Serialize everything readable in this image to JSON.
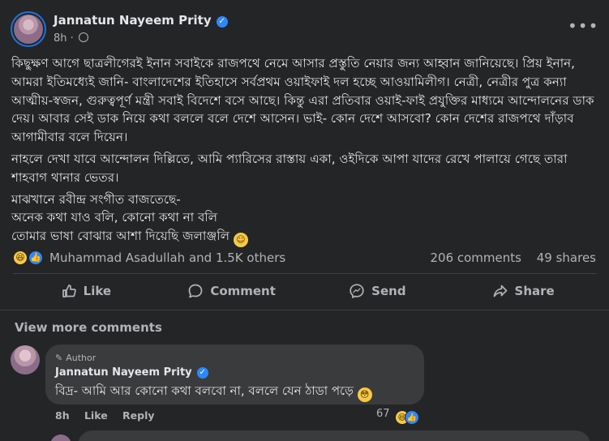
{
  "post": {
    "author": "Jannatun Nayeem Prity",
    "time": "8h",
    "separator": "·",
    "paragraphs": [
      "কিছুক্ষণ আগে ছাত্রলীগেরই ইনান সবাইকে রাজপথে নেমে আসার প্রস্তুতি নেয়ার জন্য আহ্বান জানিয়েছে। প্রিয় ইনান, আমরা ইতিমধ্যেই জানি- বাংলাদেশের ইতিহাসে সর্বপ্রথম ওয়াইফাই দল হচ্ছে আওয়ামিলীগ। নেত্রী, নেত্রীর পুত্র কন্যা আত্মীয়-স্বজন, গুরুত্বপূর্ণ মন্ত্রী সবাই বিদেশে বসে আছে। কিন্তু এরা প্রতিবার ওয়াই-ফাই প্রযুক্তির মাধ্যমে আন্দোলনের ডাক দেয়। আবার সেই ডাক নিয়ে কথা বললে বলে দেশে আসেন। ভাই- কোন দেশে আসবো? কোন দেশের রাজপথে দাঁড়াব আগামীবার বলে দিয়েন।",
      "নাহলে দেখা যাবে আন্দোলন দিল্লিতে, আমি প্যারিসের রাস্তায় একা, ওইদিকে আপা যাদের রেখে পালায়ে গেছে তারা শাহবাগ থানার ভেতর।"
    ],
    "lines_tail": [
      "মাঝখানে রবীন্দ্র সংগীত বাজতেছে-",
      "অনেক কথা যাও বলি, কোনো কথা না বলি",
      "তোমার ভাষা বোঝার আশা দিয়েছি জলাঞ্জলি"
    ],
    "tail_emoji": "☺"
  },
  "reactions": {
    "laugh_glyph": "😆",
    "like_glyph": "👍",
    "names": "Muhammad Asadullah and 1.5K others",
    "comments": "206 comments",
    "shares": "49 shares"
  },
  "actions": {
    "like": "Like",
    "comment": "Comment",
    "send": "Send",
    "share": "Share"
  },
  "comments": {
    "view_more": "View more comments",
    "items": [
      {
        "badge": "Author",
        "name": "Jannatun Nayeem Prity",
        "text": "বিদ্র- আমি আর কোনো কথা বলবো না, বললে যেন ঠাডা পড়ে",
        "text_emoji": "😳",
        "time": "8h",
        "like": "Like",
        "reply": "Reply",
        "reaction_count": "67"
      }
    ]
  },
  "colors": {
    "background": "#242526",
    "bubble": "#3a3b3c",
    "primary_text": "#e4e6eb",
    "secondary_text": "#b0b3b8",
    "verified": "#2d88ff"
  }
}
